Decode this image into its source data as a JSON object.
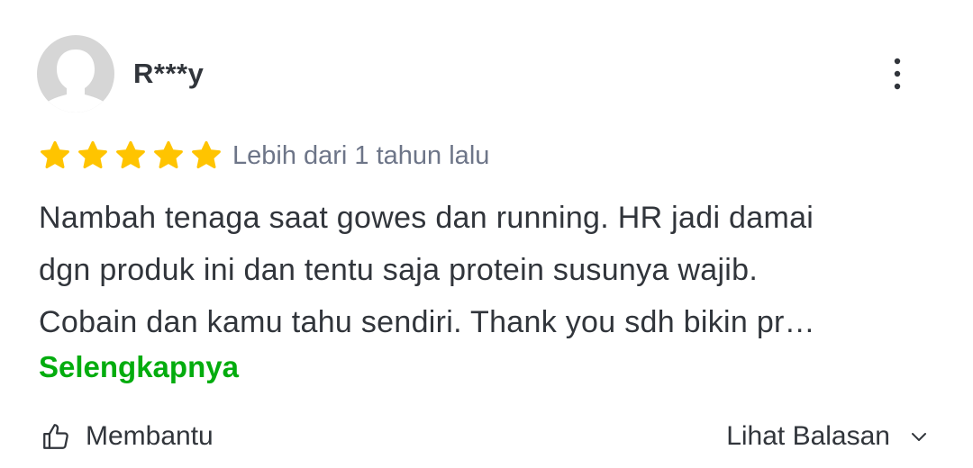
{
  "reviewer": {
    "name": "R***y",
    "avatar_icon": "default-user-avatar-icon"
  },
  "menu": {
    "icon": "more-vertical-icon"
  },
  "rating": {
    "stars": 5,
    "max_stars": 5,
    "star_color": "#ffc400",
    "icon": "star-icon"
  },
  "review": {
    "time": "Lebih dari 1 tahun lalu",
    "lines": [
      "Nambah tenaga saat gowes dan running. HR jadi damai",
      "dgn produk ini dan tentu saja protein susunya wajib.",
      "Cobain dan kamu tahu sendiri. Thank you sdh bikin pr…"
    ],
    "read_more": "Selengkapnya"
  },
  "actions": {
    "helpful_label": "Membantu",
    "helpful_icon": "thumbs-up-icon",
    "replies_label": "Lihat Balasan",
    "replies_icon": "chevron-down-icon"
  },
  "colors": {
    "text": "#31353b",
    "muted": "#6d7588",
    "accent": "#03ac0e",
    "avatar_bg": "#d6d6d6"
  }
}
